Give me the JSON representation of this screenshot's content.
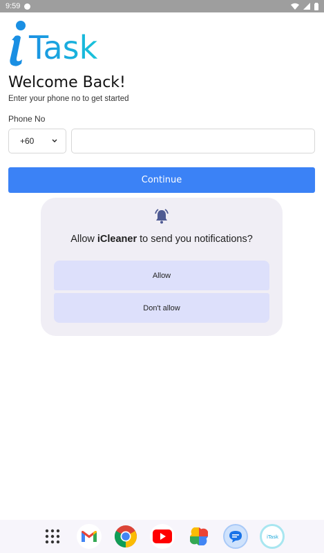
{
  "status_bar": {
    "time": "9:59"
  },
  "app": {
    "logo_text": "iTask"
  },
  "welcome": {
    "title": "Welcome Back!",
    "subtitle": "Enter your phone no to get started"
  },
  "form": {
    "phone_label": "Phone No",
    "country_code": "+60",
    "phone_value": "",
    "continue_label": "Continue"
  },
  "permission_dialog": {
    "text_prefix": "Allow ",
    "app_name": "iCleaner",
    "text_suffix": " to send you notifications?",
    "allow_label": "Allow",
    "deny_label": "Don't allow"
  },
  "dock": {
    "apps": [
      "app-drawer-icon",
      "gmail-icon",
      "chrome-icon",
      "youtube-icon",
      "photos-icon",
      "messages-icon",
      "itask-icon"
    ]
  },
  "colors": {
    "primary": "#3b82f6",
    "logo_blue": "#1a8fe3",
    "logo_cyan": "#19c3d9",
    "dialog_bg": "#f0eef5",
    "dialog_button": "#dde0fb"
  }
}
